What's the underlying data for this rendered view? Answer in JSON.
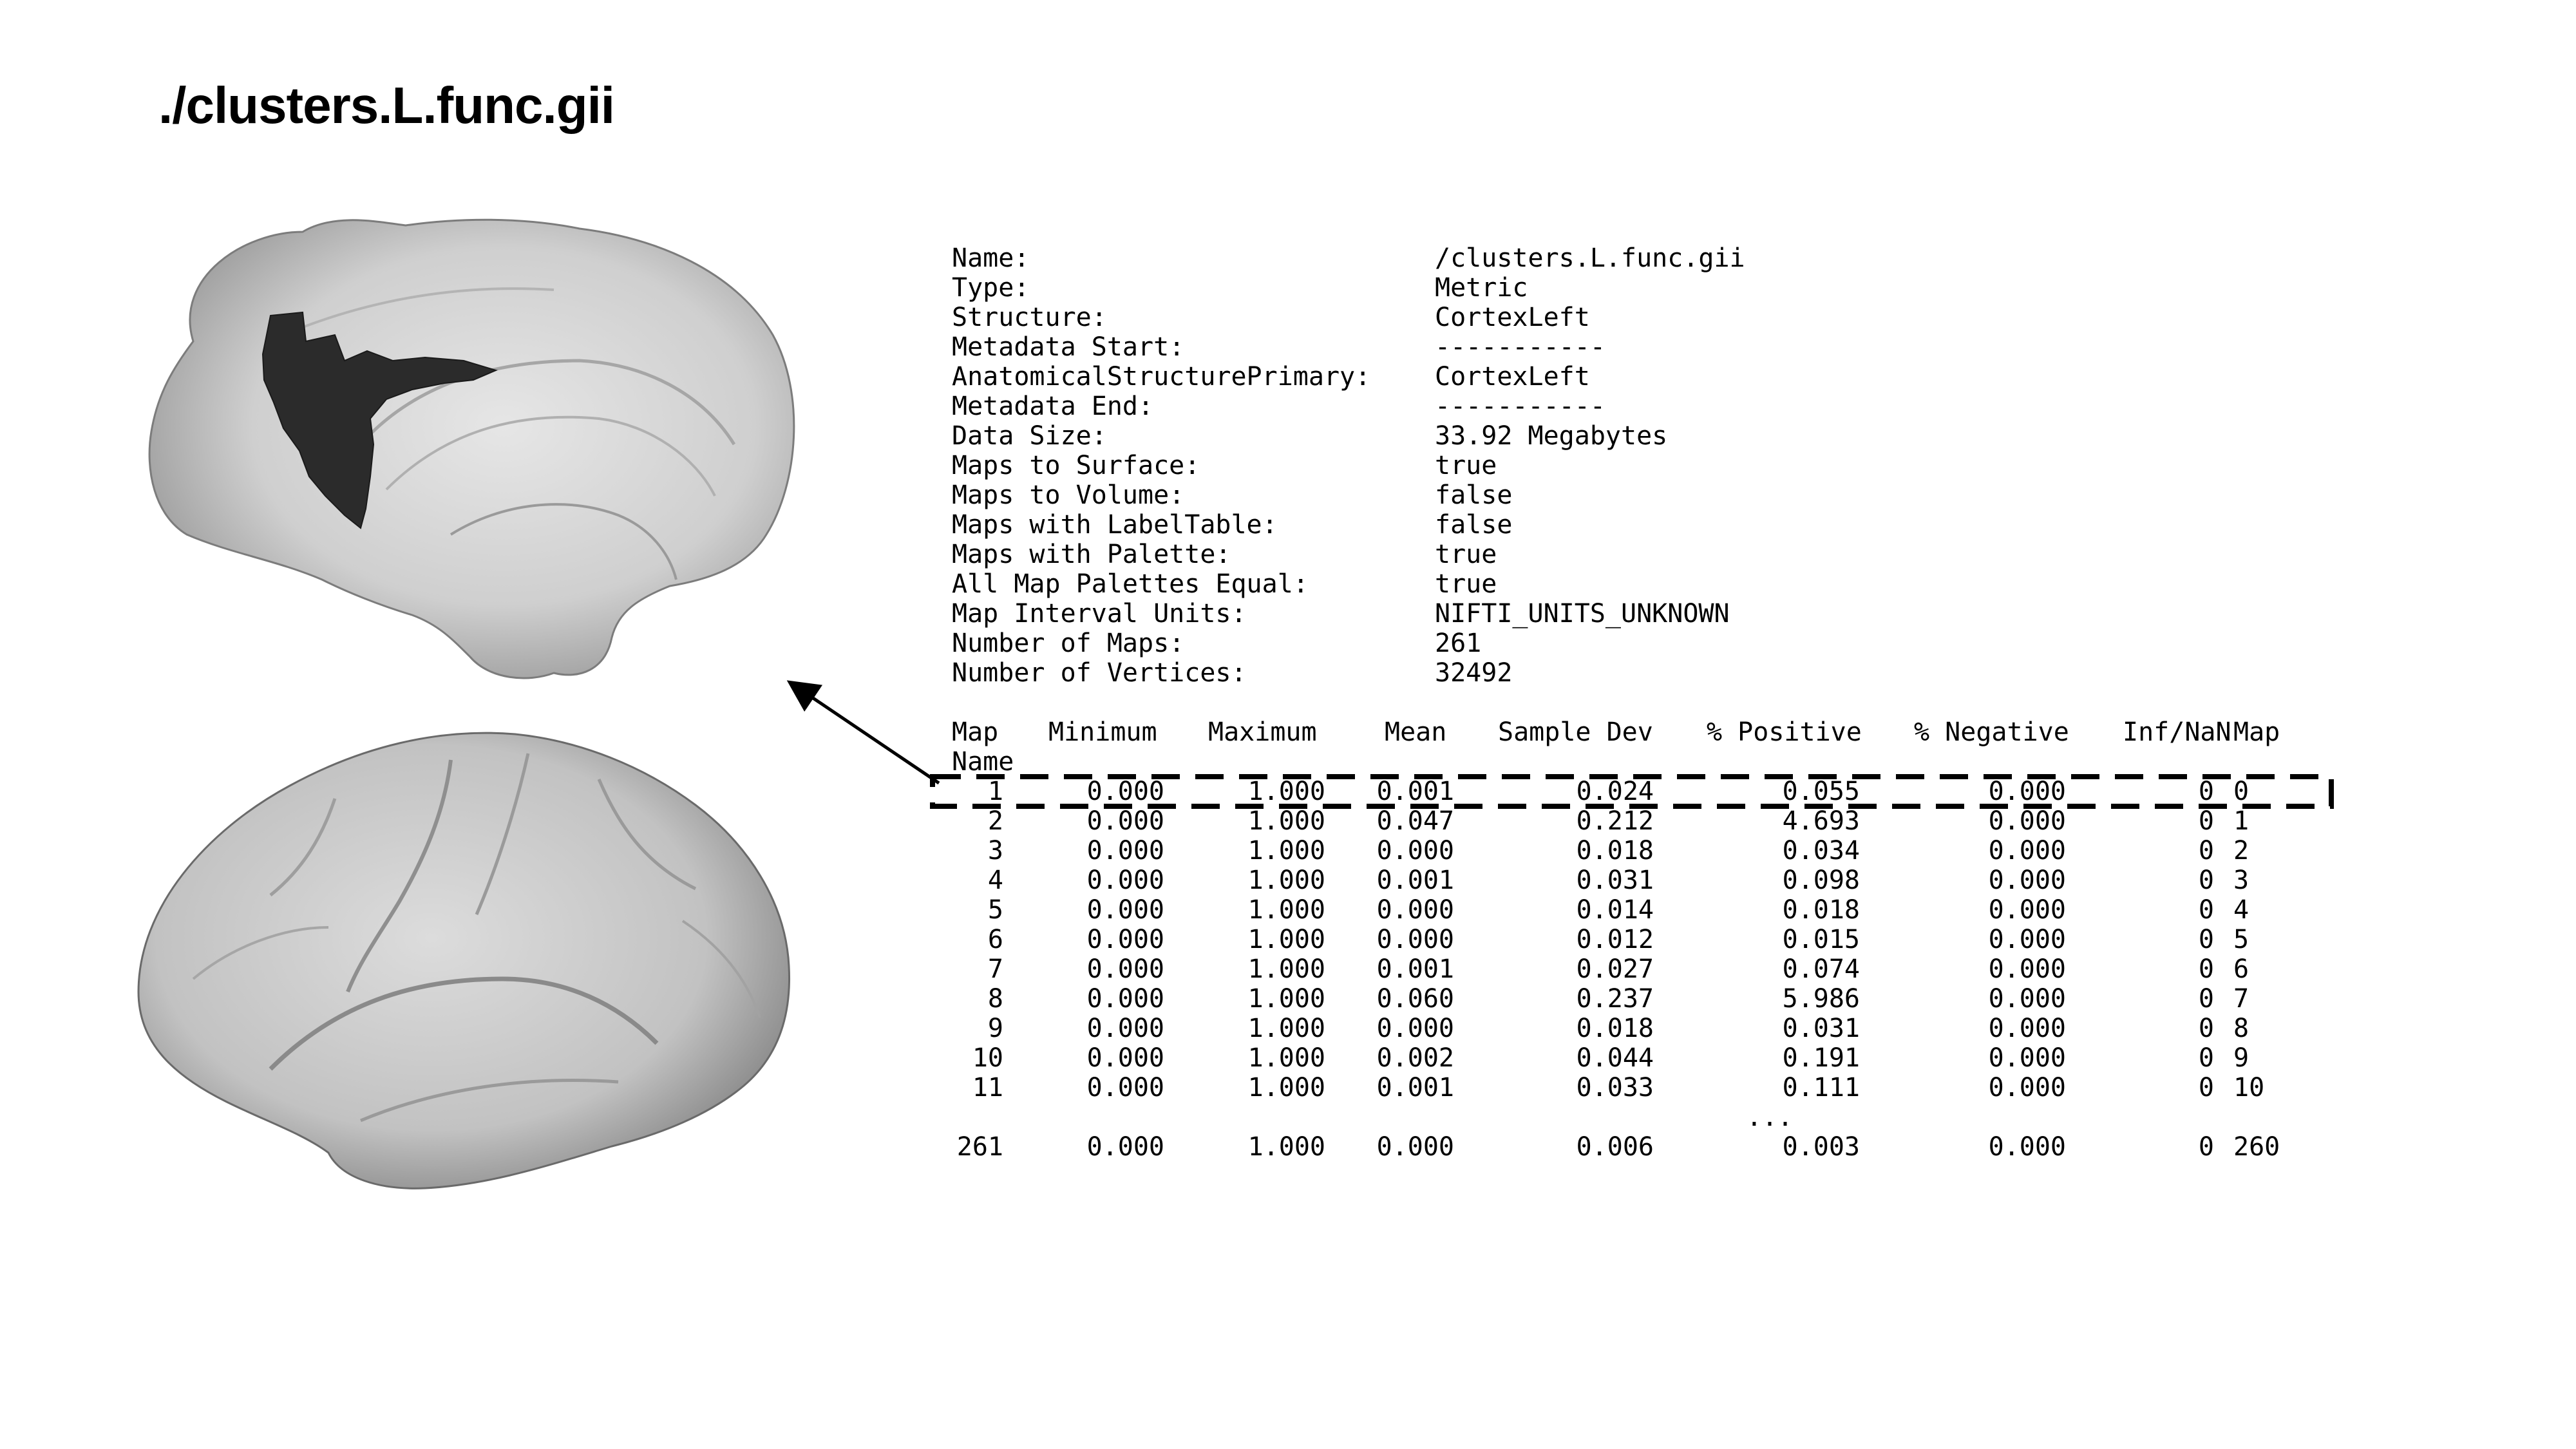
{
  "title": "./clusters.L.func.gii",
  "info": [
    {
      "key": "Name:",
      "value": "/clusters.L.func.gii"
    },
    {
      "key": "Type:",
      "value": "Metric"
    },
    {
      "key": "Structure:",
      "value": "CortexLeft"
    },
    {
      "key": "Metadata Start:",
      "value": "-----------"
    },
    {
      "key": "AnatomicalStructurePrimary:",
      "value": "CortexLeft"
    },
    {
      "key": "Metadata End:",
      "value": "-----------"
    },
    {
      "key": "Data Size:",
      "value": "33.92 Megabytes"
    },
    {
      "key": "Maps to Surface:",
      "value": "true"
    },
    {
      "key": "Maps to Volume:",
      "value": "false"
    },
    {
      "key": "Maps with LabelTable:",
      "value": "false"
    },
    {
      "key": "Maps with Palette:",
      "value": "true"
    },
    {
      "key": "All Map Palettes Equal:",
      "value": "true"
    },
    {
      "key": "Map Interval Units:",
      "value": "NIFTI_UNITS_UNKNOWN"
    },
    {
      "key": "Number of Maps:",
      "value": "261"
    },
    {
      "key": "Number of Vertices:",
      "value": "32492"
    }
  ],
  "stats": {
    "headers": {
      "map": "Map",
      "minimum": "Minimum",
      "maximum": "Maximum",
      "mean": "Mean",
      "sample_dev": "Sample Dev",
      "positive": "% Positive",
      "negative": "% Negative",
      "inf_nan": "Inf/NaN",
      "map_name": "Map",
      "name": "Name"
    },
    "rows": [
      [
        "1",
        "0.000",
        "1.000",
        "0.001",
        "0.024",
        "0.055",
        "0.000",
        "0",
        "0"
      ],
      [
        "2",
        "0.000",
        "1.000",
        "0.047",
        "0.212",
        "4.693",
        "0.000",
        "0",
        "1"
      ],
      [
        "3",
        "0.000",
        "1.000",
        "0.000",
        "0.018",
        "0.034",
        "0.000",
        "0",
        "2"
      ],
      [
        "4",
        "0.000",
        "1.000",
        "0.001",
        "0.031",
        "0.098",
        "0.000",
        "0",
        "3"
      ],
      [
        "5",
        "0.000",
        "1.000",
        "0.000",
        "0.014",
        "0.018",
        "0.000",
        "0",
        "4"
      ],
      [
        "6",
        "0.000",
        "1.000",
        "0.000",
        "0.012",
        "0.015",
        "0.000",
        "0",
        "5"
      ],
      [
        "7",
        "0.000",
        "1.000",
        "0.001",
        "0.027",
        "0.074",
        "0.000",
        "0",
        "6"
      ],
      [
        "8",
        "0.000",
        "1.000",
        "0.060",
        "0.237",
        "5.986",
        "0.000",
        "0",
        "7"
      ],
      [
        "9",
        "0.000",
        "1.000",
        "0.000",
        "0.018",
        "0.031",
        "0.000",
        "0",
        "8"
      ],
      [
        "10",
        "0.000",
        "1.000",
        "0.002",
        "0.044",
        "0.191",
        "0.000",
        "0",
        "9"
      ],
      [
        "11",
        "0.000",
        "1.000",
        "0.001",
        "0.033",
        "0.111",
        "0.000",
        "0",
        "10"
      ]
    ],
    "ellipsis": "...",
    "last_row": [
      "261",
      "0.000",
      "1.000",
      "0.000",
      "0.006",
      "0.003",
      "0.000",
      "0",
      "260"
    ]
  },
  "colors": {
    "brain_surface": "#c9c9c9",
    "cluster": "#2b2b2b",
    "highlight_box": "#000000"
  }
}
